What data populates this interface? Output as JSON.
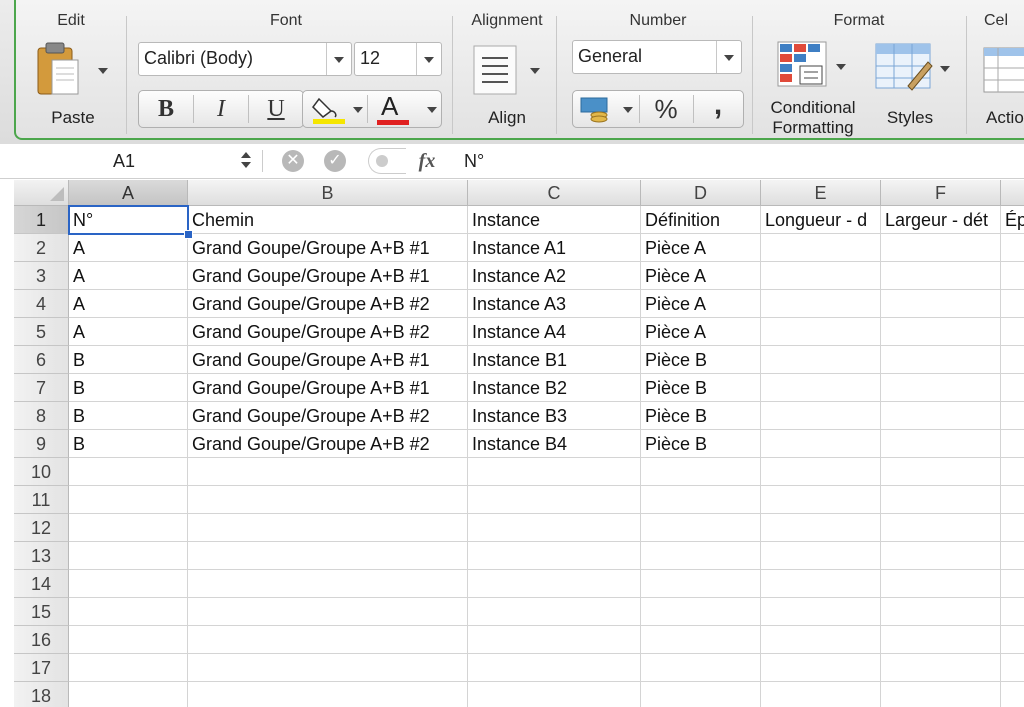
{
  "ribbon": {
    "groups": {
      "edit": "Edit",
      "font": "Font",
      "alignment": "Alignment",
      "number": "Number",
      "format": "Format",
      "cells": "Cel"
    },
    "paste_label": "Paste",
    "font_name": "Calibri (Body)",
    "font_size": "12",
    "bold": "B",
    "italic": "I",
    "underline": "U",
    "font_color_glyph": "A",
    "align_label": "Align",
    "number_format": "General",
    "percent": "%",
    "comma": ",",
    "conditional_line1": "Conditional",
    "conditional_line2": "Formatting",
    "styles_label": "Styles",
    "actions_label": "Actio",
    "colors": {
      "fill": "#f5e600",
      "font": "#e02020",
      "accent_border": "#4ca64c"
    }
  },
  "formula_bar": {
    "name_box": "A1",
    "fx": "fx",
    "content": "N°"
  },
  "sheet": {
    "columns": [
      "A",
      "B",
      "C",
      "D",
      "E",
      "F"
    ],
    "rows": [
      "1",
      "2",
      "3",
      "4",
      "5",
      "6",
      "7",
      "8",
      "9",
      "10",
      "11",
      "12",
      "13",
      "14",
      "15",
      "16",
      "17",
      "18"
    ],
    "header": [
      "N°",
      "Chemin",
      "Instance",
      "Définition",
      "Longueur - d",
      "Largeur - dét",
      "Ép"
    ],
    "data": [
      [
        "A",
        "Grand Goupe/Groupe A+B #1",
        "Instance A1",
        "Pièce A"
      ],
      [
        "A",
        "Grand Goupe/Groupe A+B #1",
        "Instance A2",
        "Pièce A"
      ],
      [
        "A",
        "Grand Goupe/Groupe A+B #2",
        "Instance A3",
        "Pièce A"
      ],
      [
        "A",
        "Grand Goupe/Groupe A+B #2",
        "Instance A4",
        "Pièce A"
      ],
      [
        "B",
        "Grand Goupe/Groupe A+B #1",
        "Instance B1",
        "Pièce B"
      ],
      [
        "B",
        "Grand Goupe/Groupe A+B #1",
        "Instance B2",
        "Pièce B"
      ],
      [
        "B",
        "Grand Goupe/Groupe A+B #2",
        "Instance B3",
        "Pièce B"
      ],
      [
        "B",
        "Grand Goupe/Groupe A+B #2",
        "Instance B4",
        "Pièce B"
      ]
    ]
  }
}
